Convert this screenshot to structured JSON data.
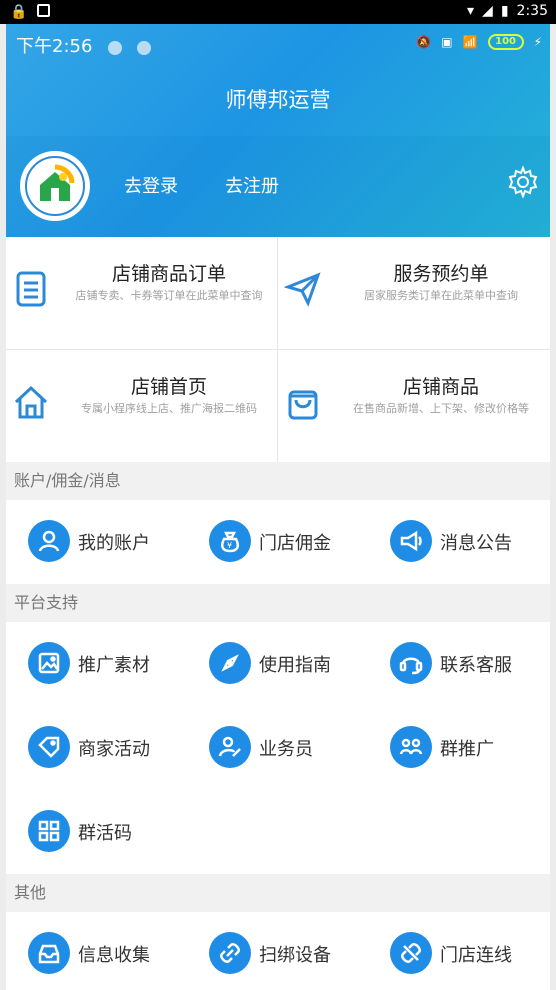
{
  "status": {
    "time": "下午2:56",
    "sys_time": "2:35",
    "battery": "100"
  },
  "app": {
    "title": "师傅邦运营"
  },
  "user": {
    "login": "去登录",
    "register": "去注册"
  },
  "quick": [
    {
      "title": "店铺商品订单",
      "subtitle": "店铺专卖、卡券等订单在此菜单中查询"
    },
    {
      "title": "服务预约单",
      "subtitle": "居家服务类订单在此菜单中查询"
    },
    {
      "title": "店铺首页",
      "subtitle": "专属小程序线上店、推广海报二维码"
    },
    {
      "title": "店铺商品",
      "subtitle": "在售商品新增、上下架、修改价格等"
    }
  ],
  "sections": {
    "account": {
      "title": "账户/佣金/消息",
      "items": [
        "我的账户",
        "门店佣金",
        "消息公告"
      ]
    },
    "support": {
      "title": "平台支持",
      "items": [
        "推广素材",
        "使用指南",
        "联系客服",
        "商家活动",
        "业务员",
        "群推广",
        "群活码"
      ]
    },
    "other": {
      "title": "其他",
      "items": [
        "信息收集",
        "扫绑设备",
        "门店连线"
      ]
    }
  },
  "colors": {
    "accent": "#1f8ce6",
    "header": "#1e95e3"
  }
}
